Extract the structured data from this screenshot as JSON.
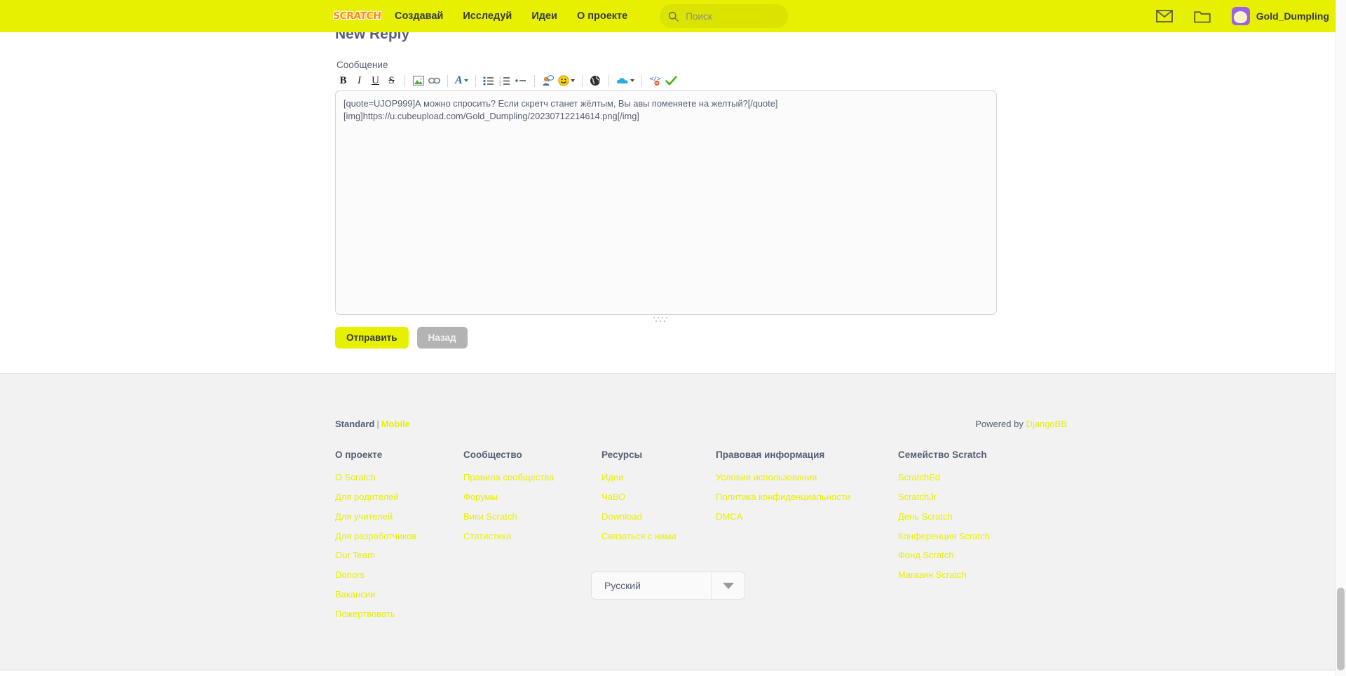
{
  "nav": {
    "logo_text": "SCRATCH",
    "links": [
      {
        "label": "Создавай"
      },
      {
        "label": "Исследуй"
      },
      {
        "label": "Идеи"
      },
      {
        "label": "О проекте"
      }
    ],
    "search_placeholder": "Поиск",
    "messages_icon": "envelope-icon",
    "folder_icon": "folder-icon",
    "username": "Gold_Dumpling",
    "bg_color": "#e6f000"
  },
  "page": {
    "title": "New Reply",
    "message_label": "Сообщение"
  },
  "toolbar": {
    "items": [
      {
        "name": "bold",
        "glyph": "B"
      },
      {
        "name": "italic",
        "glyph": "I"
      },
      {
        "name": "underline",
        "glyph": "U"
      },
      {
        "name": "strikethrough",
        "glyph": "S"
      },
      {
        "name": "image",
        "glyph": ""
      },
      {
        "name": "link",
        "glyph": ""
      },
      {
        "name": "font-color",
        "glyph": "A"
      },
      {
        "name": "bullet-list",
        "glyph": ""
      },
      {
        "name": "numbered-list",
        "glyph": ""
      },
      {
        "name": "horizontal-rule",
        "glyph": ""
      },
      {
        "name": "quote",
        "glyph": ""
      },
      {
        "name": "emoticon",
        "glyph": ""
      },
      {
        "name": "globe",
        "glyph": ""
      },
      {
        "name": "cloud",
        "glyph": ""
      },
      {
        "name": "code",
        "glyph": ""
      },
      {
        "name": "checkmark",
        "glyph": ""
      }
    ]
  },
  "editor": {
    "content": "[quote=UJOP999]А можно спросить? Если скретч станет жёлтым, Вы авы поменяете на желтый?[/quote]\n[img]https://u.cubeupload.com/Gold_Dumpling/20230712214614.png[/img]"
  },
  "buttons": {
    "submit": "Отправить",
    "back": "Назад"
  },
  "footer": {
    "mode_standard": "Standard",
    "mode_separator": "|",
    "mode_mobile": "Mobile",
    "powered_prefix": "Powered by ",
    "powered_link": "DjangoBB",
    "columns": [
      {
        "heading": "О проекте",
        "links": [
          "О Scratch",
          "Для родителей",
          "Для учителей",
          "Для разработчиков",
          "Our Team",
          "Donors",
          "Вакансии",
          "Пожертвовать"
        ]
      },
      {
        "heading": "Сообщество",
        "links": [
          "Правила сообщества",
          "Форумы",
          "Вики Scratch",
          "Статистика"
        ]
      },
      {
        "heading": "Ресурсы",
        "links": [
          "Идеи",
          "ЧаВО",
          "Download",
          "Связаться с нами"
        ]
      },
      {
        "heading": "Правовая информация",
        "links": [
          "Условия использования",
          "Политика конфиденциальности",
          "DMCA"
        ]
      },
      {
        "heading": "Семейство Scratch",
        "links": [
          "ScratchEd",
          "ScratchJr",
          "День Scratch",
          "Конференция Scratch",
          "Фонд Scratch",
          "Магазин Scratch"
        ]
      }
    ],
    "language": "Русский",
    "link_color": "#e6f000",
    "bg_color": "#f2f2f2"
  }
}
